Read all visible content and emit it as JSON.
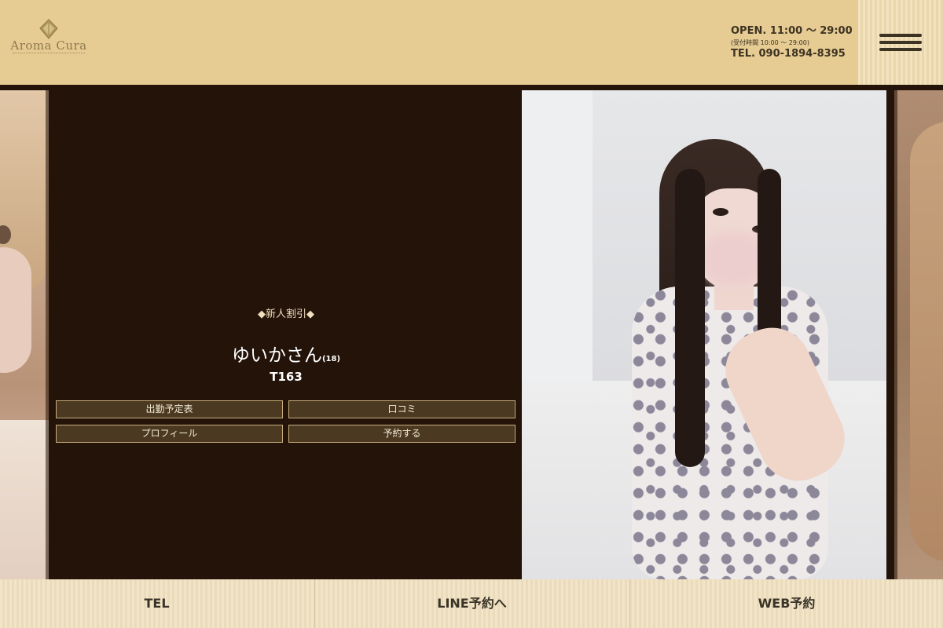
{
  "header": {
    "logo_text": "Aroma Cura",
    "hours": "OPEN.  11:00 〜 29:00",
    "hours_note": "(受付時間 10:00 〜 29:00)",
    "tel": "TEL.  090-1894-8395"
  },
  "profile": {
    "catch_copy": "◆新人割引◆",
    "name": "ゆいかさん",
    "age": "(18)",
    "height": "T163",
    "buttons": [
      "出勤予定表",
      "口コミ",
      "プロフィール",
      "予約する"
    ]
  },
  "bottom_nav": {
    "tel": "TEL",
    "line": "LINE予約へ",
    "web": "WEB予約"
  },
  "colors": {
    "header_bg": "#e6cb93",
    "panel_bg": "#231309",
    "button_bg": "#4b3922",
    "button_border": "#c8ad7c"
  }
}
